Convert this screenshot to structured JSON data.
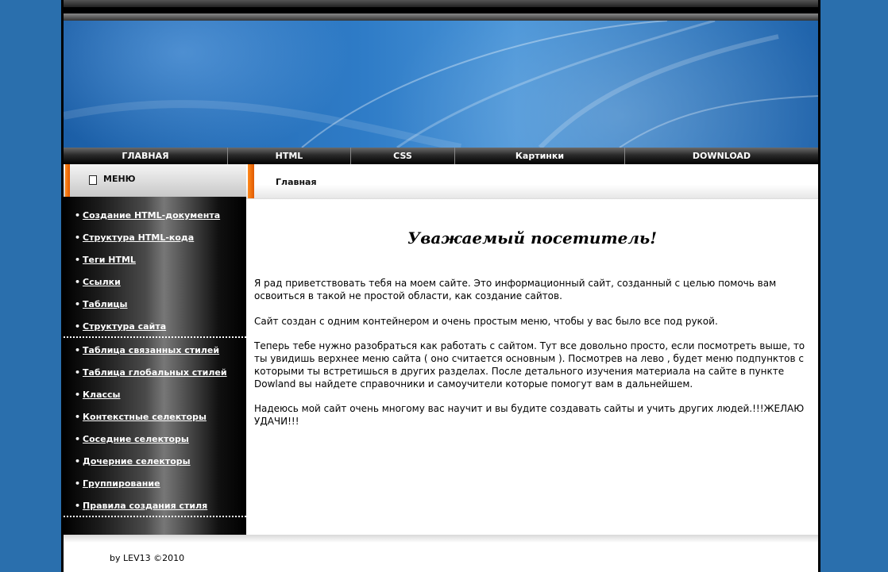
{
  "nav": {
    "items": [
      {
        "label": "ГЛАВНАЯ",
        "width": 207
      },
      {
        "label": "HTML",
        "width": 155
      },
      {
        "label": "CSS",
        "width": 131
      },
      {
        "label": "Картинки",
        "width": 214
      },
      {
        "label": "DOWNLOAD",
        "width": 243
      }
    ]
  },
  "sidebar": {
    "title": "МЕНЮ",
    "groups": [
      [
        "Создание HTML-документа",
        "Структура HTML-кода",
        "Теги HTML",
        "Ссылки",
        "Таблицы",
        "Структура сайта"
      ],
      [
        "Таблица связанных стилей",
        "Таблица глобальных стилей",
        "Классы",
        "Контекстные селекторы",
        "Соседние селекторы",
        "Дочерние селекторы",
        "Группирование",
        "Правила создания стиля"
      ]
    ]
  },
  "content": {
    "breadcrumb": "Главная",
    "heading": "Уважаемый посетитель!",
    "paragraphs": [
      "Я рад приветствовать тебя на моем сайте. Это информационный сайт, созданный с целью помочь вам освоиться в такой не простой области, как создание сайтов.",
      "Сайт создан с одним контейнером и очень простым меню, чтобы у вас было все под рукой.",
      "Теперь тебе нужно разобраться как работать с сайтом. Тут все довольно просто, если посмотреть выше, то ты увидишь верхнее меню сайта ( оно считается основным ). Посмотрев на лево , будет меню подпунктов с которыми ты встретишься в других разделах. После детального изучения материала на сайте в пункте Dowland вы найдете справочники и самоучители которые помогут вам в дальнейшем.",
      "Надеюсь мой сайт очень многому вас научит и вы будите создавать сайты и учить других людей.!!!ЖЕЛАЮ УДАЧИ!!!"
    ]
  },
  "footer": {
    "text": "by LEV13 ©2010"
  },
  "colors": {
    "background": "#2a6fad",
    "accent": "#ff8a1e"
  }
}
